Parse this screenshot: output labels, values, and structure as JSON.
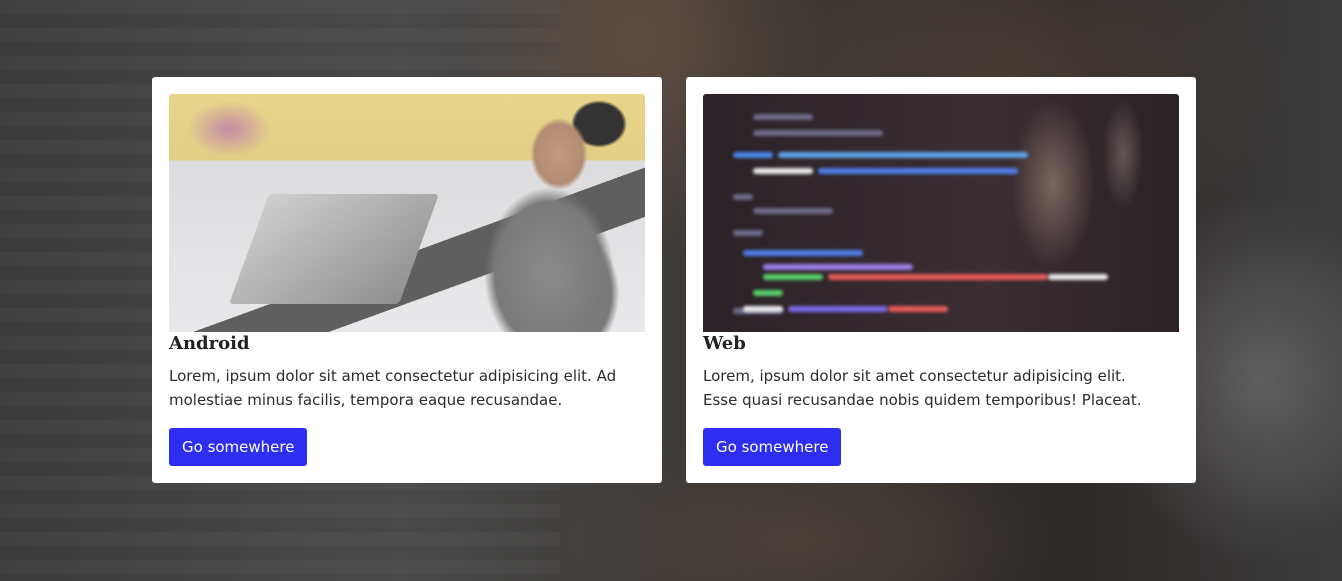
{
  "cards": [
    {
      "title": "Android",
      "text": "Lorem, ipsum dolor sit amet consectetur adipisicing elit. Ad molestiae minus facilis, tempora eaque recusandae.",
      "button_label": "Go somewhere"
    },
    {
      "title": "Web",
      "text": "Lorem, ipsum dolor sit amet consectetur adipisicing elit. Esse quasi recusandae nobis quidem temporibus! Placeat.",
      "button_label": "Go somewhere"
    }
  ],
  "colors": {
    "button": "#2d2ef0",
    "card_background": "#ffffff",
    "overlay": "#3f3f3f"
  }
}
